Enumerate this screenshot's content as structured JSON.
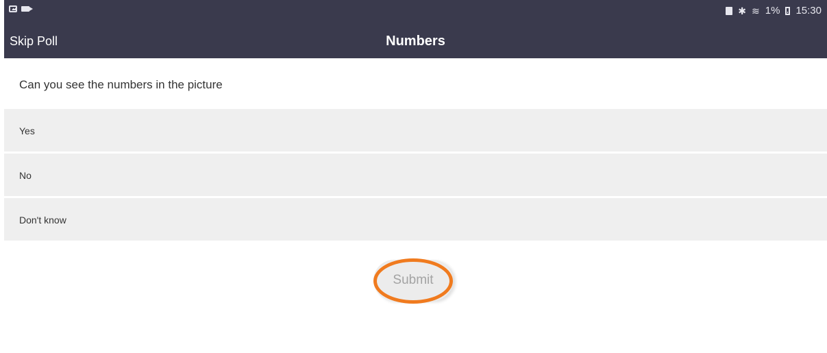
{
  "status_bar": {
    "left_icons": [
      "image-icon",
      "video-camera-icon"
    ],
    "right_icons": [
      "sim-icon",
      "bluetooth-icon",
      "wifi-icon",
      "battery-icon"
    ],
    "battery": "1%",
    "time": "15:30"
  },
  "nav": {
    "skip_label": "Skip Poll",
    "title": "Numbers"
  },
  "poll": {
    "question": "Can you see the numbers in the picture",
    "options": [
      "Yes",
      "No",
      "Don't know"
    ]
  },
  "submit": {
    "label": "Submit"
  },
  "colors": {
    "header_bg": "#3a3a4d",
    "option_bg": "#efefef",
    "highlight": "#f07b1f"
  }
}
